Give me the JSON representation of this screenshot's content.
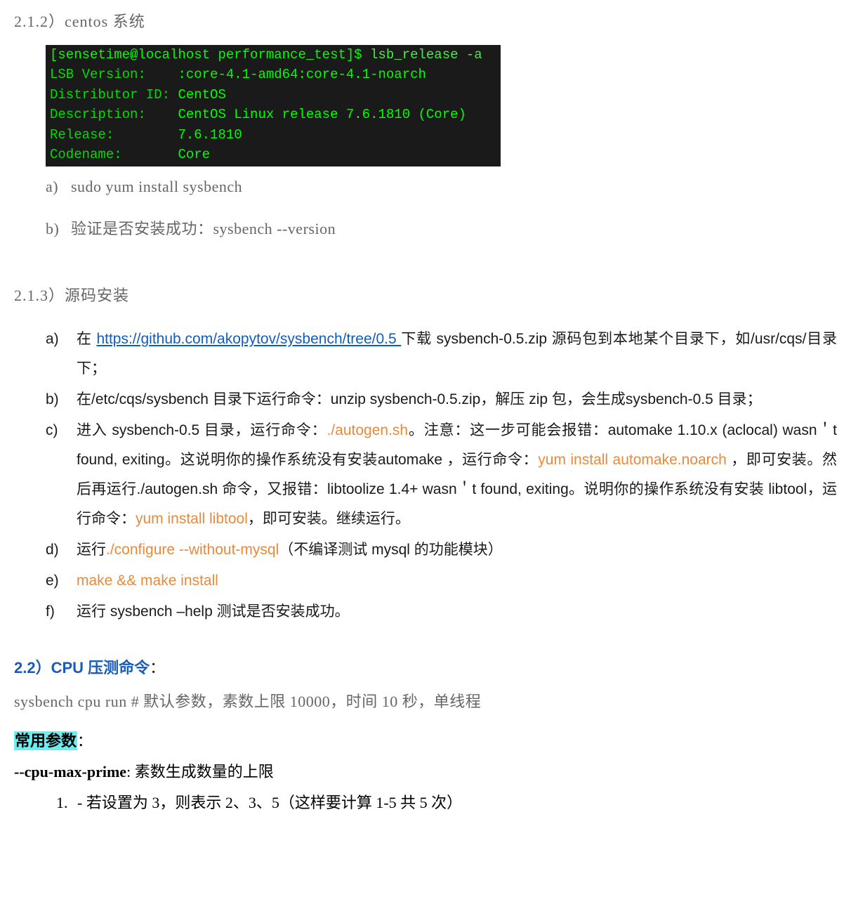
{
  "s212": {
    "heading": "2.1.2）centos 系统",
    "terminal": {
      "prompt": "[sensetime@localhost performance_test]$ ",
      "command": "lsb_release -a",
      "rows": [
        {
          "label": "LSB Version:",
          "pad": "    ",
          "value": ":core-4.1-amd64:core-4.1-noarch"
        },
        {
          "label": "Distributor ID:",
          "pad": " ",
          "value": "CentOS"
        },
        {
          "label": "Description:",
          "pad": "    ",
          "value": "CentOS Linux release 7.6.1810 (Core)"
        },
        {
          "label": "Release:",
          "pad": "        ",
          "value": "7.6.1810"
        },
        {
          "label": "Codename:",
          "pad": "       ",
          "value": "Core"
        }
      ]
    },
    "items": {
      "a": {
        "marker": "a)",
        "text": "sudo yum install sysbench"
      },
      "b": {
        "marker": "b)",
        "text": "验证是否安装成功：sysbench --version"
      }
    }
  },
  "s213": {
    "heading": "2.1.3）源码安装",
    "a": {
      "marker": "a)",
      "t1": "在 ",
      "link": "https://github.com/akopytov/sysbench/tree/0.5 ",
      "t2": "下载 sysbench-0.5.zip 源码包到本地某个目录下，如/usr/cqs/目录下；"
    },
    "b": {
      "marker": "b)",
      "text": "在/etc/cqs/sysbench 目录下运行命令：unzip sysbench-0.5.zip，解压 zip 包，会生成sysbench-0.5 目录；"
    },
    "c": {
      "marker": "c)",
      "t1": "进入 sysbench-0.5 目录，运行命令：",
      "o1": "./autogen.sh",
      "t2": "。注意：这一步可能会报错：automake 1.10.x (aclocal) wasn＇t found, exiting。这说明你的操作系统没有安装automake ，运行命令：",
      "o2": "yum install automake.noarch",
      "t3": " ，即可安装。然后再运行./autogen.sh 命令，又报错：libtoolize 1.4+ wasn＇t found, exiting。说明你的操作系统没有安装 libtool，运行命令：",
      "o3": "yum install libtool",
      "t4": "，即可安装。继续运行。"
    },
    "d": {
      "marker": "d)",
      "t1": "运行",
      "o1": "./configure --without-mysql",
      "t2": "（不编译测试 mysql 的功能模块）"
    },
    "e": {
      "marker": "e)",
      "o1": "make && make install"
    },
    "f": {
      "marker": "f)",
      "text": "运行 sysbench –help 测试是否安装成功。"
    }
  },
  "s22": {
    "heading": "2.2）CPU 压测命令",
    "colon": "：",
    "cmd": "sysbench cpu run    # 默认参数，素数上限 10000，时间 10 秒，单线程",
    "param_hl": "常用参数",
    "param_hl_colon": "：",
    "param_name": "--cpu-max-prime",
    "param_desc": ": 素数生成数量的上限",
    "sub1_num": "1.",
    "sub1_text": "- 若设置为 3，则表示 2、3、5（这样要计算 1-5 共 5 次）"
  }
}
